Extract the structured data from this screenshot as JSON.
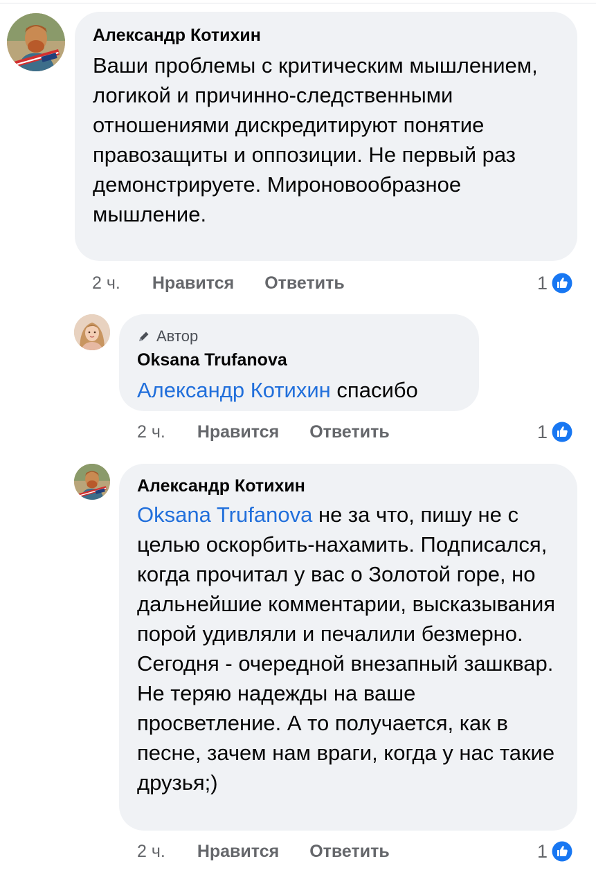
{
  "comments": [
    {
      "author": "Александр Котихин",
      "text": "Ваши проблемы с критическим мышлением, логикой и причинно-следственными отношениями дискредитируют понятие правозащиты и оппозиции. Не первый раз демонстрируете. Мироновообразное мышление.",
      "time": "2 ч.",
      "like_label": "Нравится",
      "reply_label": "Ответить",
      "reactions_count": "1"
    },
    {
      "badge": "Автор",
      "author": "Oksana Trufanova",
      "mention": "Александр Котихин",
      "text": "спасибо",
      "time": "2 ч.",
      "like_label": "Нравится",
      "reply_label": "Ответить",
      "reactions_count": "1"
    },
    {
      "author": "Александр Котихин",
      "mention": "Oksana Trufanova",
      "text": "не за что, пишу не с целью оскорбить-нахамить. Подписался, когда прочитал у вас о Золотой горе, но дальнейшие комментарии, высказывания порой удивляли и печалили безмерно. Сегодня - очередной внезапный зашквар. Не теряю надежды на ваше просветление. А то получается, как в песне, зачем нам враги, когда у нас такие друзья;)",
      "time": "2 ч.",
      "like_label": "Нравится",
      "reply_label": "Ответить",
      "reactions_count": "1"
    }
  ],
  "colors": {
    "bubble": "#f0f2f5",
    "mention": "#216fdb",
    "meta": "#65676b",
    "like_blue": "#1877f2"
  },
  "icons": [
    "avatar-van-gogh",
    "avatar-woman",
    "pen-icon",
    "like-reaction-icon"
  ]
}
